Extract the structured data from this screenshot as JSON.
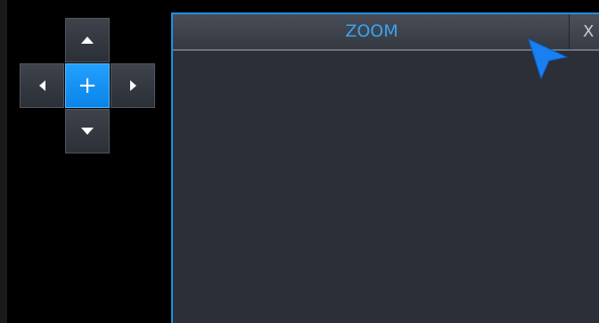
{
  "dpad": {
    "up_icon": "arrow-up-icon",
    "down_icon": "arrow-down-icon",
    "left_icon": "arrow-left-icon",
    "right_icon": "arrow-right-icon",
    "center_label": "+",
    "center_color": "#1a96f5"
  },
  "zoom_window": {
    "title": "ZOOM",
    "close_label": "X",
    "border_color": "#1e90e6",
    "title_color": "#3aa3f5"
  },
  "cursor": {
    "icon": "mouse-pointer-icon",
    "color": "#1a7ff0"
  }
}
